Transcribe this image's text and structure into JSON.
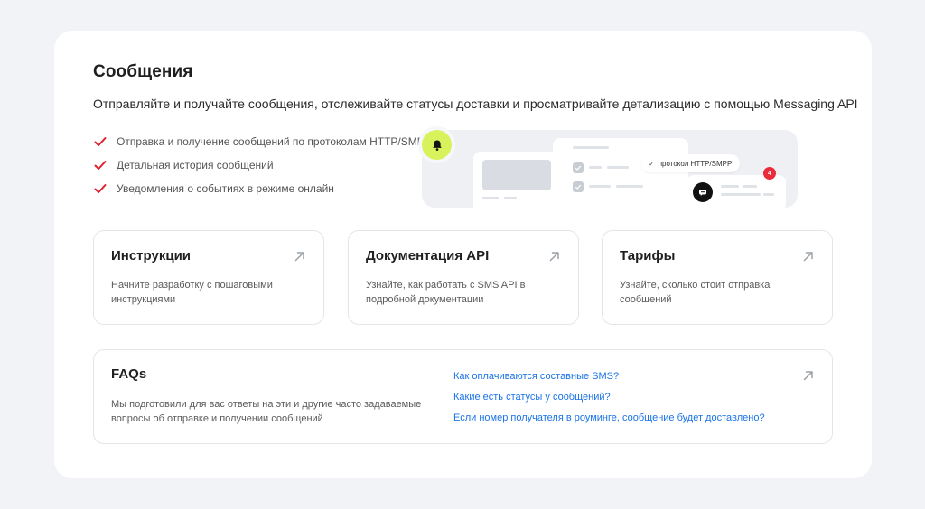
{
  "header": {
    "title": "Сообщения",
    "subtitle": "Отправляйте и получайте сообщения, отслеживайте статусы доставки и просматривайте детализацию с помощью Messaging API"
  },
  "features": [
    "Отправка и получение сообщений по протоколам HTTP/SMPP",
    "Детальная история сообщений",
    "Уведомления о событиях в режиме онлайн"
  ],
  "illustration": {
    "protocol_label": "протокол HTTP/SMPP",
    "badge_count": "4",
    "icons": [
      "bell-icon",
      "chat-icon",
      "check-icon"
    ]
  },
  "cards": [
    {
      "title": "Инструкции",
      "description": "Начните разработку с пошаговыми инструкциями"
    },
    {
      "title": "Документация API",
      "description": "Узнайте, как работать с SMS API в подробной документации"
    },
    {
      "title": "Тарифы",
      "description": "Узнайте, сколько стоит отправка сообщений"
    }
  ],
  "faq": {
    "title": "FAQs",
    "description": "Мы подготовили для вас ответы на эти и другие часто задаваемые вопросы об отправке и получении сообщений",
    "links": [
      "Как оплачиваются составные SMS?",
      "Какие есть статусы у сообщений?",
      "Если номер получателя в роуминге, сообщение будет доставлено?"
    ]
  },
  "colors": {
    "background": "#f2f3f7",
    "accent_check": "#e0202e",
    "link": "#1a73e8",
    "bell_bg": "#d7f25a",
    "badge": "#ea2b3b"
  }
}
